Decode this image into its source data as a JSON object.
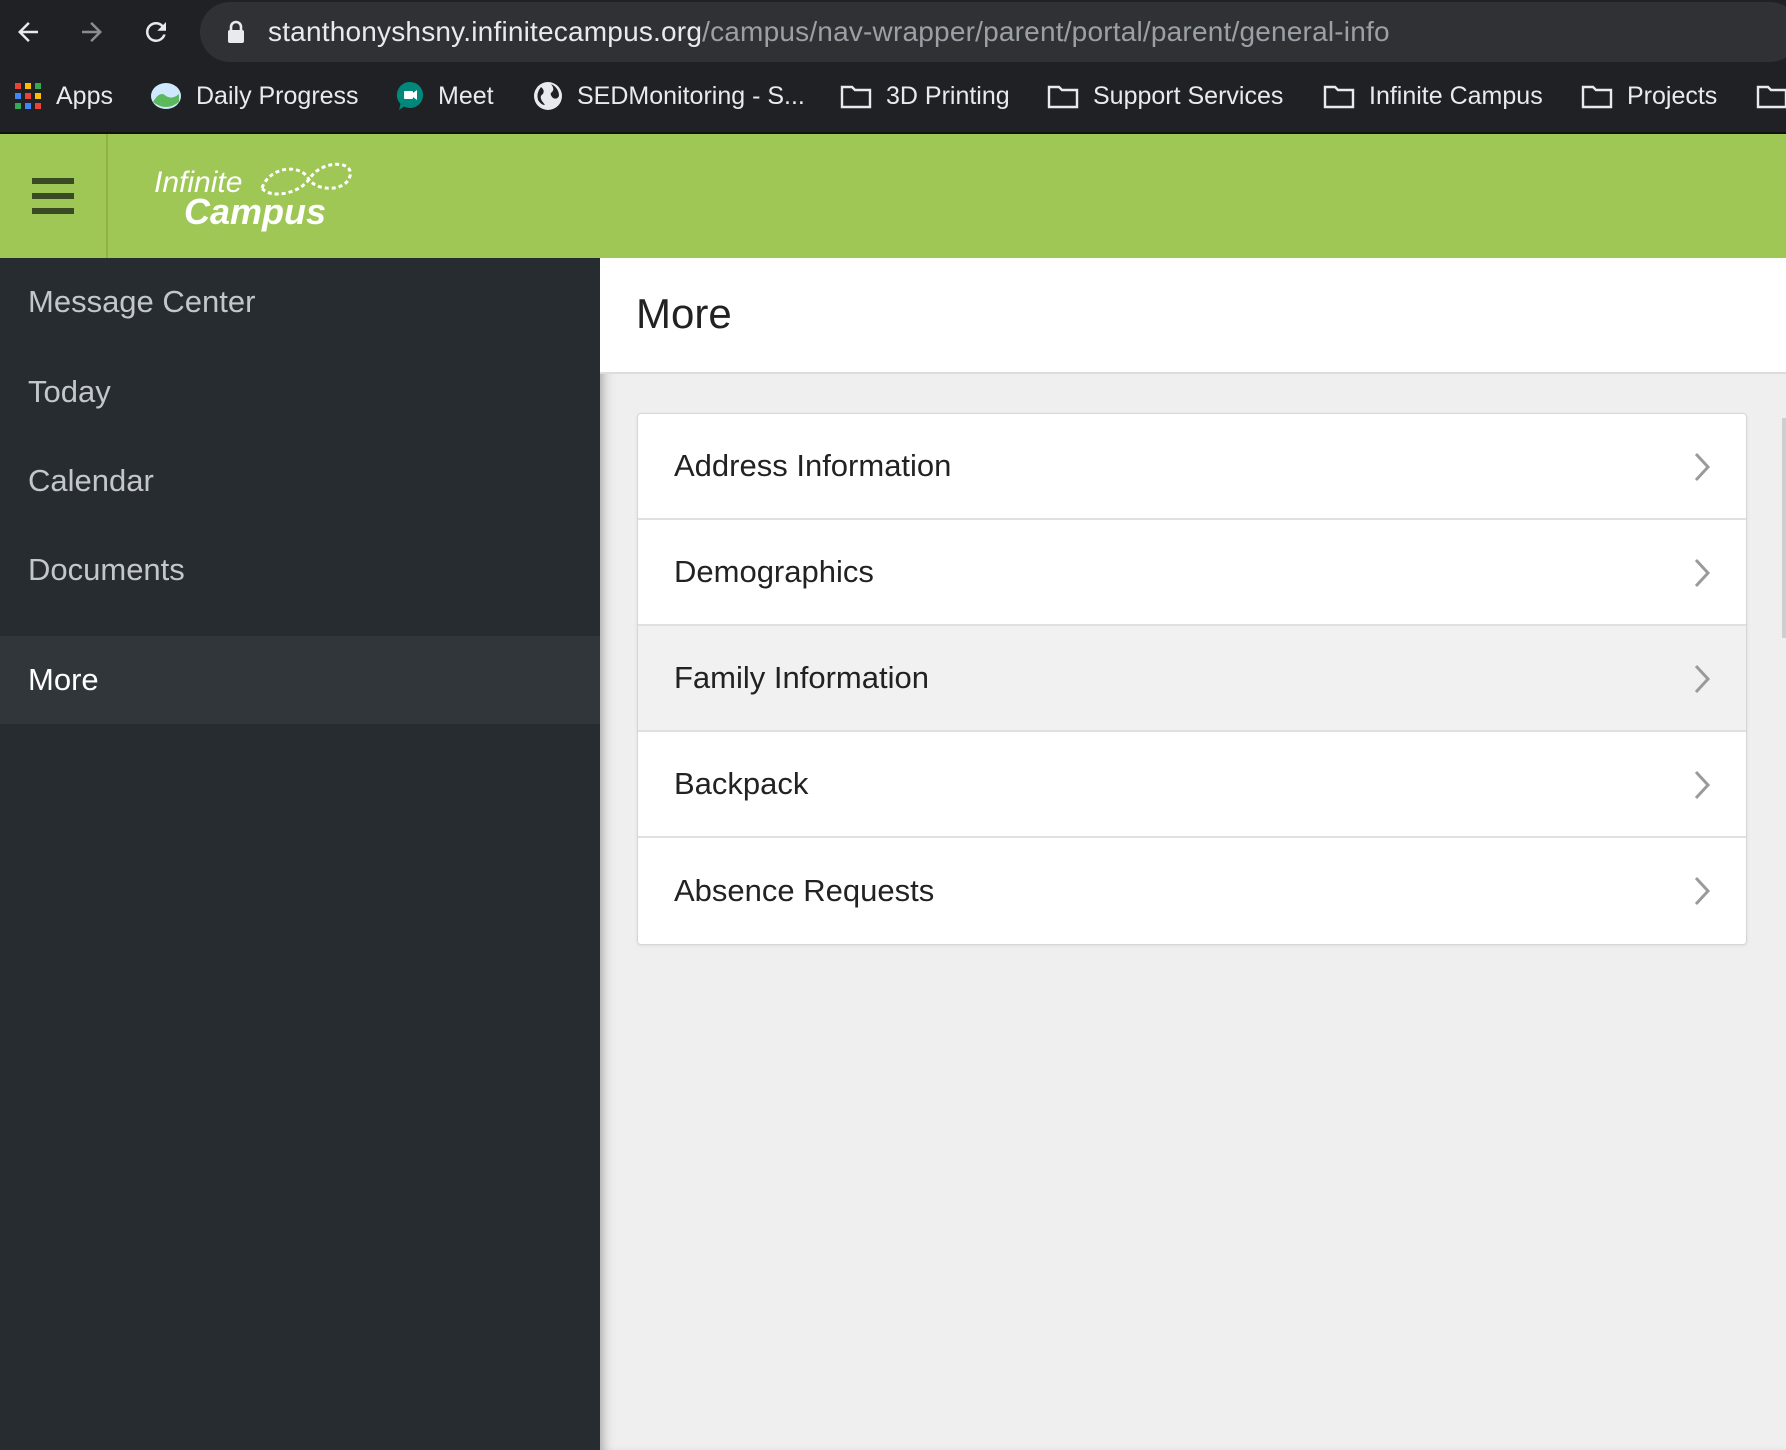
{
  "browser": {
    "url_host": "stanthonyshsny.infinitecampus.org",
    "url_path": "/campus/nav-wrapper/parent/portal/parent/general-info",
    "bookmarks": [
      {
        "label": "Apps",
        "icon": "apps-grid-icon"
      },
      {
        "label": "Daily Progress",
        "icon": "basecamp-icon"
      },
      {
        "label": "Meet",
        "icon": "meet-icon"
      },
      {
        "label": "SEDMonitoring - S...",
        "icon": "globe-icon"
      },
      {
        "label": "3D Printing",
        "icon": "folder-icon"
      },
      {
        "label": "Support Services",
        "icon": "folder-icon"
      },
      {
        "label": "Infinite Campus",
        "icon": "folder-icon"
      },
      {
        "label": "Projects",
        "icon": "folder-icon"
      }
    ]
  },
  "app": {
    "logo_line1": "Infinite",
    "logo_line2": "Campus",
    "brand_color": "#9fc756"
  },
  "sidebar": {
    "items": [
      {
        "label": "Message Center",
        "active": false
      },
      {
        "label": "Today",
        "active": false
      },
      {
        "label": "Calendar",
        "active": false
      },
      {
        "label": "Documents",
        "active": false
      },
      {
        "label": "More",
        "active": true
      }
    ]
  },
  "main": {
    "title": "More",
    "links": [
      {
        "label": "Address Information"
      },
      {
        "label": "Demographics"
      },
      {
        "label": "Family Information"
      },
      {
        "label": "Backpack"
      },
      {
        "label": "Absence Requests"
      }
    ]
  }
}
